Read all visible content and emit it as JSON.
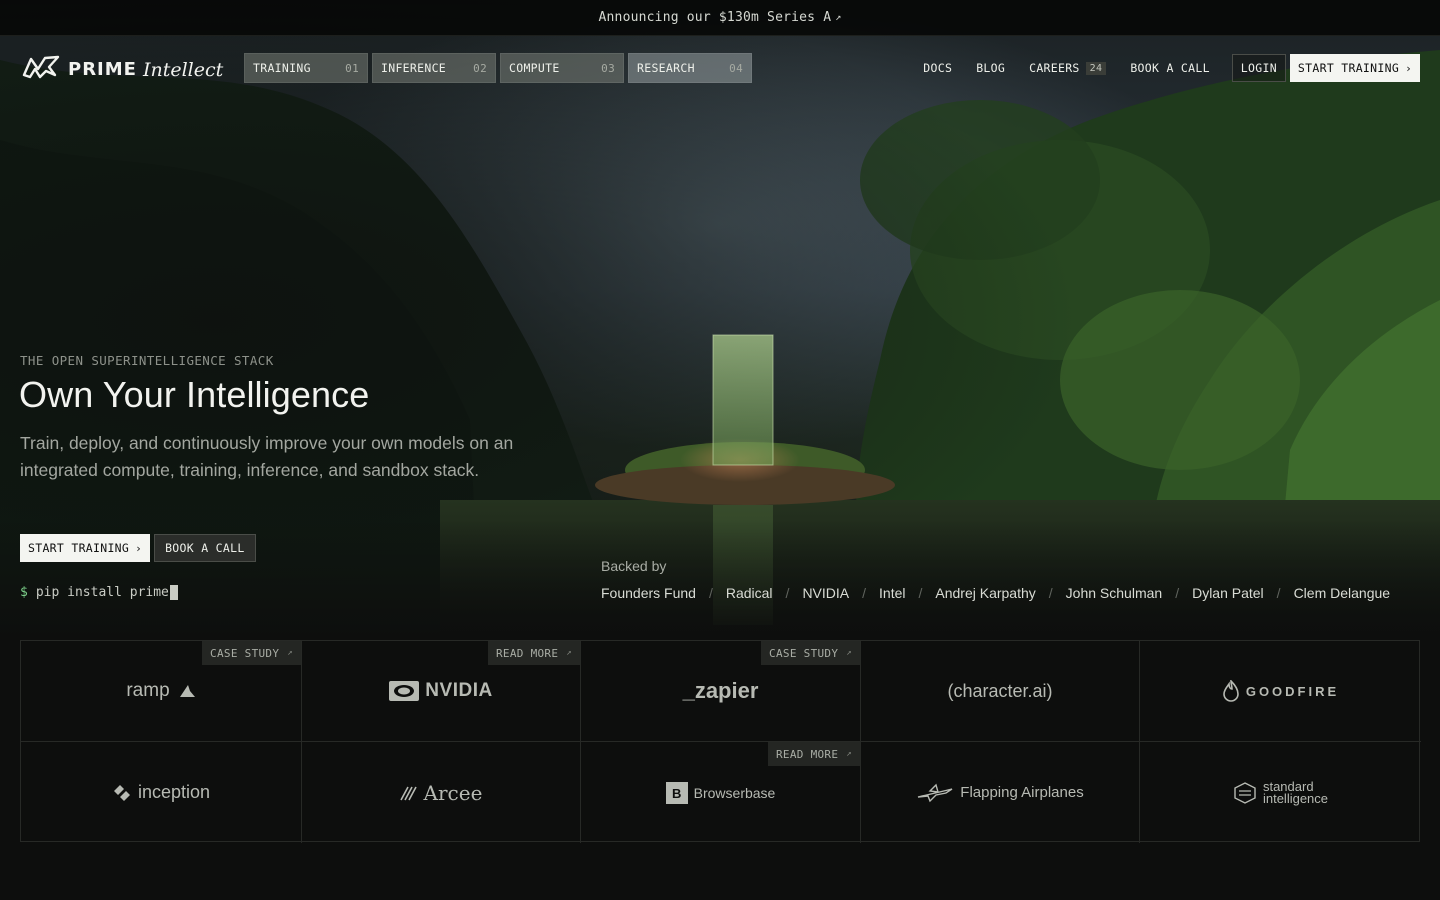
{
  "announcement": {
    "text": "Announcing our $130m Series A",
    "arrow": "↗"
  },
  "brand": {
    "name_bold": "PRIME",
    "name_italic": "Intellect"
  },
  "nav": {
    "tabs": [
      {
        "label": "TRAINING",
        "num": "01"
      },
      {
        "label": "INFERENCE",
        "num": "02"
      },
      {
        "label": "COMPUTE",
        "num": "03"
      },
      {
        "label": "RESEARCH",
        "num": "04"
      }
    ],
    "links": {
      "docs": "DOCS",
      "blog": "BLOG",
      "careers": "CAREERS",
      "careers_count": "24",
      "book": "BOOK A CALL"
    },
    "login": "LOGIN",
    "start": "START TRAINING"
  },
  "hero": {
    "eyebrow": "THE OPEN SUPERINTELLIGENCE STACK",
    "title": "Own Your Intelligence",
    "subtitle": "Train, deploy, and continuously improve your own models on an integrated compute, training, inference, and sandbox stack.",
    "cta_primary": "START TRAINING",
    "cta_secondary": "BOOK A CALL",
    "terminal_prompt": "$",
    "terminal_cmd": "pip install prime"
  },
  "backed": {
    "label": "Backed by",
    "investors": [
      "Founders Fund",
      "Radical",
      "NVIDIA",
      "Intel",
      "Andrej Karpathy",
      "John Schulman",
      "Dylan Patel",
      "Clem Delangue"
    ],
    "separator": "/"
  },
  "customers": [
    {
      "name": "ramp",
      "tag": "CASE STUDY"
    },
    {
      "name": "NVIDIA",
      "tag": "READ MORE"
    },
    {
      "name": "_zapier",
      "tag": "CASE STUDY"
    },
    {
      "name": "(character.ai)",
      "tag": ""
    },
    {
      "name": "GOODFIRE",
      "tag": ""
    },
    {
      "name": "inception",
      "tag": ""
    },
    {
      "name": "Arcee",
      "tag": ""
    },
    {
      "name": "Browserbase",
      "tag": "READ MORE"
    },
    {
      "name": "Flapping Airplanes",
      "tag": ""
    },
    {
      "name": "standard",
      "name2": "intelligence",
      "tag": ""
    }
  ],
  "tag_arrow": "↗",
  "colors": {
    "background": "#0d0e0d",
    "accent_green": "#7dd08a",
    "button_light": "#f4f5f1"
  }
}
